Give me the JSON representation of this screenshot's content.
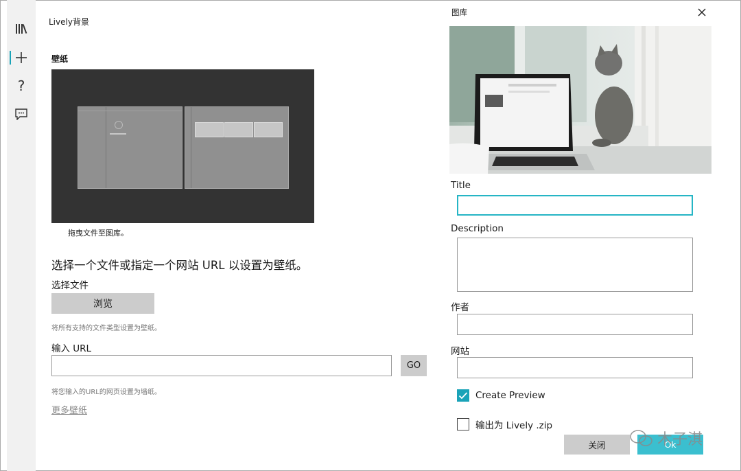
{
  "app": {
    "title": "Lively背景"
  },
  "sidebar": {
    "items": [
      {
        "icon": "library-icon"
      },
      {
        "icon": "add-icon",
        "active": true
      },
      {
        "icon": "help-icon"
      },
      {
        "icon": "feedback-icon"
      }
    ]
  },
  "main": {
    "section_title": "壁纸",
    "drag_caption": "拖曳文件至图库。",
    "instruction": "选择一个文件或指定一个网站 URL 以设置为壁纸。",
    "file_label": "选择文件",
    "browse_label": "浏览",
    "file_hint": "将所有支持的文件类型设置为壁纸。",
    "url_label": "输入 URL",
    "url_value": "",
    "go_label": "GO",
    "url_hint": "将您输入的URL的网页设置为墙纸。",
    "more_link": "更多壁纸"
  },
  "dialog": {
    "title": "图库",
    "fields": {
      "title_label": "Title",
      "title_value": "",
      "description_label": "Description",
      "description_value": "",
      "author_label": "作者",
      "author_value": "",
      "website_label": "网站",
      "website_value": ""
    },
    "create_preview": {
      "label": "Create Preview",
      "checked": true
    },
    "export_zip": {
      "label": "输出为 Lively .zip",
      "checked": false
    },
    "cancel_label": "关闭",
    "ok_label": "Ok"
  },
  "watermark": {
    "text": "木子淇"
  },
  "colors": {
    "accent": "#1aa3b8",
    "sidebar_bg": "#f1f1f1",
    "button_gray": "#cccccc",
    "preview_bg": "#333333"
  }
}
